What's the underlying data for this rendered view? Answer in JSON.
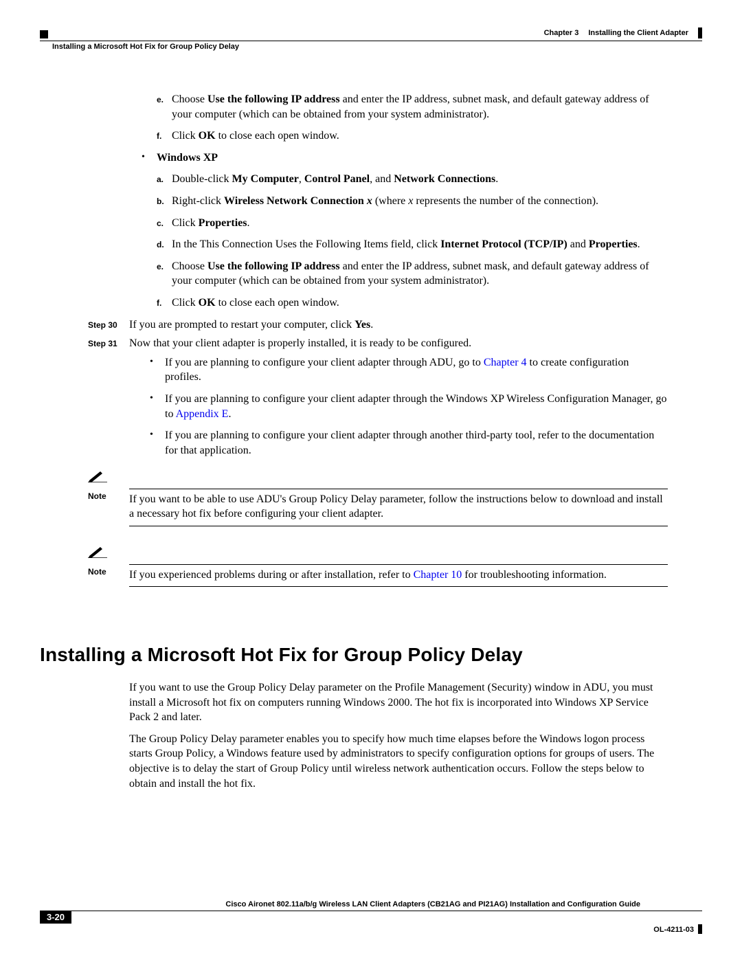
{
  "header": {
    "chapter_label": "Chapter 3",
    "chapter_title": "Installing the Client Adapter",
    "section_title": "Installing a Microsoft Hot Fix for Group Policy Delay"
  },
  "steps_top": {
    "e_pre": "Choose ",
    "e_b": "Use the following IP address",
    "e_post": " and enter the IP address, subnet mask, and default gateway address of your computer (which can be obtained from your system administrator).",
    "f_pre": "Click ",
    "f_b": "OK",
    "f_post": " to close each open window."
  },
  "winxp": {
    "label": "Windows XP",
    "a_pre": "Double-click ",
    "a_b1": "My Computer",
    "a_mid1": ", ",
    "a_b2": "Control Panel",
    "a_mid2": ", and ",
    "a_b3": "Network Connections",
    "a_post": ".",
    "b_pre": "Right-click ",
    "b_b": "Wireless Network Connection ",
    "b_i1": "x",
    "b_mid": " (where ",
    "b_i2": "x",
    "b_post": " represents the number of the connection).",
    "c_pre": "Click ",
    "c_b": "Properties",
    "c_post": ".",
    "d_pre": "In the This Connection Uses the Following Items field, click ",
    "d_b1": "Internet Protocol (TCP/IP)",
    "d_mid": " and ",
    "d_b2": "Properties",
    "d_post": ".",
    "e_pre": "Choose ",
    "e_b": "Use the following IP address",
    "e_post": " and enter the IP address, subnet mask, and default gateway address of your computer (which can be obtained from your system administrator).",
    "f_pre": "Click ",
    "f_b": "OK",
    "f_post": " to close each open window."
  },
  "step30": {
    "label": "Step 30",
    "pre": "If you are prompted to restart your computer, click ",
    "b": "Yes",
    "post": "."
  },
  "step31": {
    "label": "Step 31",
    "text": "Now that your client adapter is properly installed, it is ready to be configured.",
    "b1_pre": "If you are planning to configure your client adapter through ADU, go to ",
    "b1_link": "Chapter 4",
    "b1_post": " to create configuration profiles.",
    "b2_pre": "If you are planning to configure your client adapter through the Windows XP Wireless Configuration Manager, go to ",
    "b2_link": "Appendix E",
    "b2_post": ".",
    "b3": "If you are planning to configure your client adapter through another third-party tool, refer to the documentation for that application."
  },
  "note1": {
    "label": "Note",
    "text": "If you want to be able to use ADU's Group Policy Delay parameter, follow the instructions below to download and install a necessary hot fix before configuring your client adapter."
  },
  "note2": {
    "label": "Note",
    "pre": "If you experienced problems during or after installation, refer to ",
    "link": "Chapter 10",
    "post": " for troubleshooting information."
  },
  "h1": "Installing a Microsoft Hot Fix for Group Policy Delay",
  "para1": "If you want to use the Group Policy Delay parameter on the Profile Management (Security) window in ADU, you must install a Microsoft hot fix on computers running Windows 2000. The hot fix is incorporated into Windows XP Service Pack 2 and later.",
  "para2": "The Group Policy Delay parameter enables you to specify how much time elapses before the Windows logon process starts Group Policy, a Windows feature used by administrators to specify configuration options for groups of users. The objective is to delay the start of Group Policy until wireless network authentication occurs. Follow the steps below to obtain and install the hot fix.",
  "footer": {
    "guide": "Cisco Aironet 802.11a/b/g Wireless LAN Client Adapters (CB21AG and PI21AG) Installation and Configuration Guide",
    "page": "3-20",
    "doc": "OL-4211-03"
  }
}
